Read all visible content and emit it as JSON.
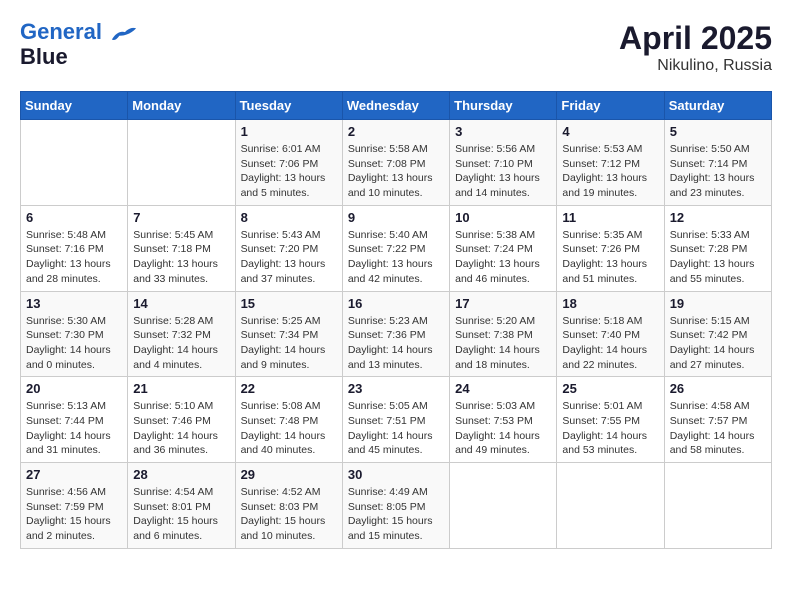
{
  "header": {
    "logo_line1": "General",
    "logo_line2": "Blue",
    "month_year": "April 2025",
    "location": "Nikulino, Russia"
  },
  "days_of_week": [
    "Sunday",
    "Monday",
    "Tuesday",
    "Wednesday",
    "Thursday",
    "Friday",
    "Saturday"
  ],
  "weeks": [
    [
      {
        "day": "",
        "info": ""
      },
      {
        "day": "",
        "info": ""
      },
      {
        "day": "1",
        "info": "Sunrise: 6:01 AM\nSunset: 7:06 PM\nDaylight: 13 hours\nand 5 minutes."
      },
      {
        "day": "2",
        "info": "Sunrise: 5:58 AM\nSunset: 7:08 PM\nDaylight: 13 hours\nand 10 minutes."
      },
      {
        "day": "3",
        "info": "Sunrise: 5:56 AM\nSunset: 7:10 PM\nDaylight: 13 hours\nand 14 minutes."
      },
      {
        "day": "4",
        "info": "Sunrise: 5:53 AM\nSunset: 7:12 PM\nDaylight: 13 hours\nand 19 minutes."
      },
      {
        "day": "5",
        "info": "Sunrise: 5:50 AM\nSunset: 7:14 PM\nDaylight: 13 hours\nand 23 minutes."
      }
    ],
    [
      {
        "day": "6",
        "info": "Sunrise: 5:48 AM\nSunset: 7:16 PM\nDaylight: 13 hours\nand 28 minutes."
      },
      {
        "day": "7",
        "info": "Sunrise: 5:45 AM\nSunset: 7:18 PM\nDaylight: 13 hours\nand 33 minutes."
      },
      {
        "day": "8",
        "info": "Sunrise: 5:43 AM\nSunset: 7:20 PM\nDaylight: 13 hours\nand 37 minutes."
      },
      {
        "day": "9",
        "info": "Sunrise: 5:40 AM\nSunset: 7:22 PM\nDaylight: 13 hours\nand 42 minutes."
      },
      {
        "day": "10",
        "info": "Sunrise: 5:38 AM\nSunset: 7:24 PM\nDaylight: 13 hours\nand 46 minutes."
      },
      {
        "day": "11",
        "info": "Sunrise: 5:35 AM\nSunset: 7:26 PM\nDaylight: 13 hours\nand 51 minutes."
      },
      {
        "day": "12",
        "info": "Sunrise: 5:33 AM\nSunset: 7:28 PM\nDaylight: 13 hours\nand 55 minutes."
      }
    ],
    [
      {
        "day": "13",
        "info": "Sunrise: 5:30 AM\nSunset: 7:30 PM\nDaylight: 14 hours\nand 0 minutes."
      },
      {
        "day": "14",
        "info": "Sunrise: 5:28 AM\nSunset: 7:32 PM\nDaylight: 14 hours\nand 4 minutes."
      },
      {
        "day": "15",
        "info": "Sunrise: 5:25 AM\nSunset: 7:34 PM\nDaylight: 14 hours\nand 9 minutes."
      },
      {
        "day": "16",
        "info": "Sunrise: 5:23 AM\nSunset: 7:36 PM\nDaylight: 14 hours\nand 13 minutes."
      },
      {
        "day": "17",
        "info": "Sunrise: 5:20 AM\nSunset: 7:38 PM\nDaylight: 14 hours\nand 18 minutes."
      },
      {
        "day": "18",
        "info": "Sunrise: 5:18 AM\nSunset: 7:40 PM\nDaylight: 14 hours\nand 22 minutes."
      },
      {
        "day": "19",
        "info": "Sunrise: 5:15 AM\nSunset: 7:42 PM\nDaylight: 14 hours\nand 27 minutes."
      }
    ],
    [
      {
        "day": "20",
        "info": "Sunrise: 5:13 AM\nSunset: 7:44 PM\nDaylight: 14 hours\nand 31 minutes."
      },
      {
        "day": "21",
        "info": "Sunrise: 5:10 AM\nSunset: 7:46 PM\nDaylight: 14 hours\nand 36 minutes."
      },
      {
        "day": "22",
        "info": "Sunrise: 5:08 AM\nSunset: 7:48 PM\nDaylight: 14 hours\nand 40 minutes."
      },
      {
        "day": "23",
        "info": "Sunrise: 5:05 AM\nSunset: 7:51 PM\nDaylight: 14 hours\nand 45 minutes."
      },
      {
        "day": "24",
        "info": "Sunrise: 5:03 AM\nSunset: 7:53 PM\nDaylight: 14 hours\nand 49 minutes."
      },
      {
        "day": "25",
        "info": "Sunrise: 5:01 AM\nSunset: 7:55 PM\nDaylight: 14 hours\nand 53 minutes."
      },
      {
        "day": "26",
        "info": "Sunrise: 4:58 AM\nSunset: 7:57 PM\nDaylight: 14 hours\nand 58 minutes."
      }
    ],
    [
      {
        "day": "27",
        "info": "Sunrise: 4:56 AM\nSunset: 7:59 PM\nDaylight: 15 hours\nand 2 minutes."
      },
      {
        "day": "28",
        "info": "Sunrise: 4:54 AM\nSunset: 8:01 PM\nDaylight: 15 hours\nand 6 minutes."
      },
      {
        "day": "29",
        "info": "Sunrise: 4:52 AM\nSunset: 8:03 PM\nDaylight: 15 hours\nand 10 minutes."
      },
      {
        "day": "30",
        "info": "Sunrise: 4:49 AM\nSunset: 8:05 PM\nDaylight: 15 hours\nand 15 minutes."
      },
      {
        "day": "",
        "info": ""
      },
      {
        "day": "",
        "info": ""
      },
      {
        "day": "",
        "info": ""
      }
    ]
  ]
}
